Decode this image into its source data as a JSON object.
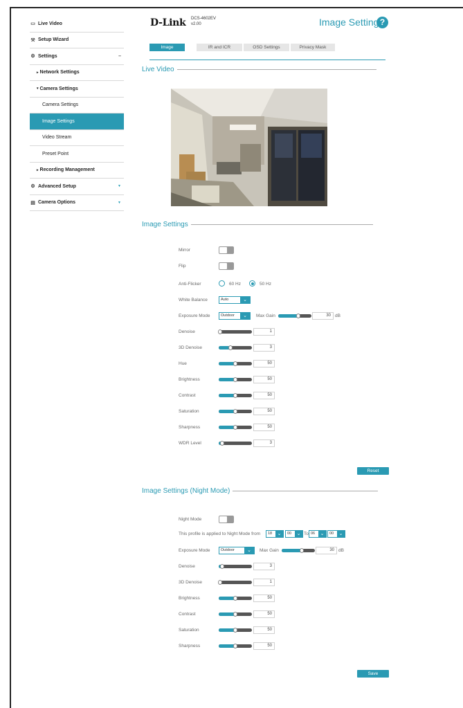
{
  "brand": {
    "logo": "D-Link",
    "model": "DCS-4602EV",
    "version": "v2.00"
  },
  "page_title": "Image Settings",
  "help_symbol": "?",
  "sidebar": {
    "items": [
      {
        "label": "Live Video",
        "icon": "video-icon"
      },
      {
        "label": "Setup Wizard",
        "icon": "wand-icon"
      },
      {
        "label": "Settings",
        "icon": "gear-icon",
        "symbol": "–"
      },
      {
        "label": "Network Settings",
        "prefix": "▸"
      },
      {
        "label": "Camera Settings",
        "prefix": "▾"
      },
      {
        "label": "Camera Settings"
      },
      {
        "label": "Image Settings"
      },
      {
        "label": "Video Stream"
      },
      {
        "label": "Preset Point"
      },
      {
        "label": "Recording Management",
        "prefix": "▸"
      },
      {
        "label": "Advanced Setup",
        "icon": "settings-icon",
        "symbol": "▼"
      },
      {
        "label": "Camera Options",
        "icon": "options-icon",
        "symbol": "▼"
      }
    ]
  },
  "tabs": [
    "Image",
    "IR and ICR",
    "OSD Settings",
    "Privacy Mask"
  ],
  "live_video": {
    "title": "Live Video"
  },
  "day": {
    "title": "Image Settings",
    "mirror_label": "Mirror",
    "flip_label": "Flip",
    "anti_flicker": {
      "label": "Anti-Flicker",
      "opt1": "60 Hz",
      "opt2": "50 Hz",
      "selected": "50 Hz"
    },
    "white_balance": {
      "label": "White Balance",
      "value": "Auto"
    },
    "exposure": {
      "label": "Exposure Mode",
      "value": "Outdoor",
      "max_gain_label": "Max Gain",
      "max_gain_value": "30",
      "max_gain_unit": "dB",
      "max_gain_level": 0.6
    },
    "sliders": [
      {
        "label": "Denoise",
        "value": "1",
        "level": 0.05
      },
      {
        "label": "3D Denoise",
        "value": "3",
        "level": 0.35
      },
      {
        "label": "Hue",
        "value": "50",
        "level": 0.5
      },
      {
        "label": "Brightness",
        "value": "50",
        "level": 0.5
      },
      {
        "label": "Contrast",
        "value": "50",
        "level": 0.5
      },
      {
        "label": "Saturation",
        "value": "50",
        "level": 0.5
      },
      {
        "label": "Sharpness",
        "value": "50",
        "level": 0.5
      },
      {
        "label": "WDR Level",
        "value": "3",
        "level": 0.1
      }
    ],
    "reset_label": "Reset"
  },
  "night": {
    "title": "Image Settings (Night Mode)",
    "night_mode_label": "Night Mode",
    "profile_text": "This profile is applied to Night Mode from",
    "from_h": "18",
    "from_m": "00",
    "to_text": "To",
    "to_h": "06",
    "to_m": "00",
    "exposure": {
      "label": "Exposure Mode",
      "value": "Outdoor",
      "max_gain_label": "Max Gain",
      "max_gain_value": "30",
      "max_gain_unit": "dB",
      "max_gain_level": 0.6
    },
    "sliders": [
      {
        "label": "Denoise",
        "value": "3",
        "level": 0.1
      },
      {
        "label": "3D Denoise",
        "value": "1",
        "level": 0.05
      },
      {
        "label": "Brightness",
        "value": "50",
        "level": 0.5
      },
      {
        "label": "Contrast",
        "value": "50",
        "level": 0.5
      },
      {
        "label": "Saturation",
        "value": "50",
        "level": 0.5
      },
      {
        "label": "Sharpness",
        "value": "50",
        "level": 0.5
      }
    ],
    "save_label": "Save"
  },
  "colors": {
    "accent": "#2a9ab3",
    "track": "#555555"
  }
}
